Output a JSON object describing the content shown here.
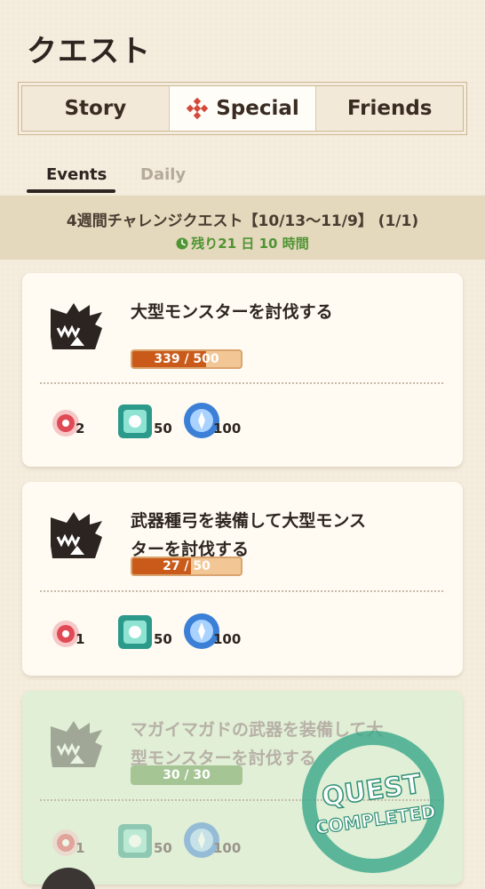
{
  "header": {
    "title": "クエスト"
  },
  "segments": [
    {
      "label": "Story",
      "icon": "none",
      "active": false
    },
    {
      "label": "Special",
      "icon": "special-diamond-icon",
      "active": true
    },
    {
      "label": "Friends",
      "icon": "none",
      "active": false
    }
  ],
  "subtabs": {
    "events": "Events",
    "daily": "Daily"
  },
  "banner": {
    "title": "4週間チャレンジクエスト【10/13〜11/9】 (1/1)",
    "time_left": "残り21 日 10 時間"
  },
  "quests": [
    {
      "title_line1": "大型モンスターを討伐する",
      "title_line2": "",
      "progress_text": "339 / 500",
      "progress": 0.678,
      "completed": false,
      "rewards": {
        "item": "2",
        "gem": "50",
        "orb": "100"
      }
    },
    {
      "title_line1": "武器種弓を装備して大型モンス",
      "title_line2": "ターを討伐する",
      "progress_text": "27 / 50",
      "progress": 0.54,
      "completed": false,
      "rewards": {
        "item": "1",
        "gem": "50",
        "orb": "100"
      }
    },
    {
      "title_line1": "マガイマガドの武器を装備して大",
      "title_line2": "型モンスターを討伐する",
      "progress_text": "30 / 30",
      "progress": 1.0,
      "completed": true,
      "stamp_line1": "QUEST",
      "stamp_line2": "COMPLETED",
      "rewards": {
        "item": "1",
        "gem": "50",
        "orb": "100"
      }
    }
  ],
  "colors": {
    "background": "#f4ecdd",
    "accent_green": "#4f9433",
    "progress_orange": "#c95a1a",
    "completed_card": "#e0efd6"
  }
}
